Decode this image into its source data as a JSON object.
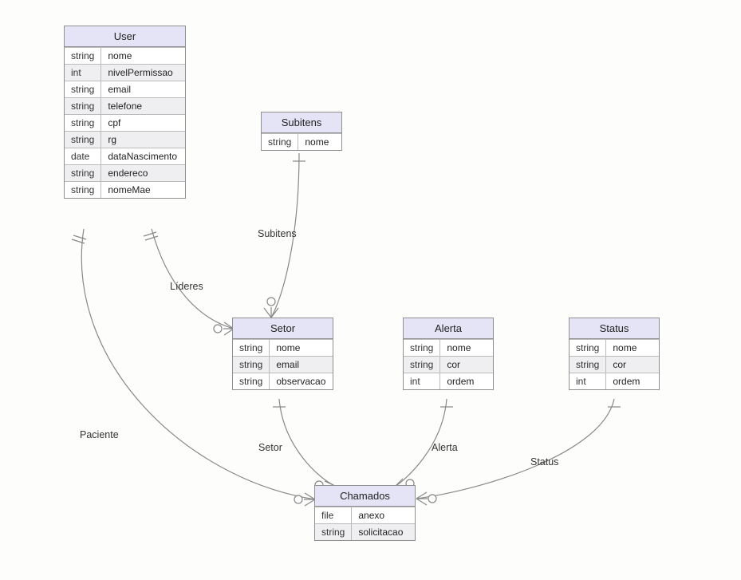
{
  "entities": {
    "user": {
      "title": "User",
      "rows": [
        {
          "type": "string",
          "name": "nome"
        },
        {
          "type": "int",
          "name": "nivelPermissao"
        },
        {
          "type": "string",
          "name": "email"
        },
        {
          "type": "string",
          "name": "telefone"
        },
        {
          "type": "string",
          "name": "cpf"
        },
        {
          "type": "string",
          "name": "rg"
        },
        {
          "type": "date",
          "name": "dataNascimento"
        },
        {
          "type": "string",
          "name": "endereco"
        },
        {
          "type": "string",
          "name": "nomeMae"
        }
      ]
    },
    "subitens": {
      "title": "Subitens",
      "rows": [
        {
          "type": "string",
          "name": "nome"
        }
      ]
    },
    "setor": {
      "title": "Setor",
      "rows": [
        {
          "type": "string",
          "name": "nome"
        },
        {
          "type": "string",
          "name": "email"
        },
        {
          "type": "string",
          "name": "observacao"
        }
      ]
    },
    "alerta": {
      "title": "Alerta",
      "rows": [
        {
          "type": "string",
          "name": "nome"
        },
        {
          "type": "string",
          "name": "cor"
        },
        {
          "type": "int",
          "name": "ordem"
        }
      ]
    },
    "status": {
      "title": "Status",
      "rows": [
        {
          "type": "string",
          "name": "nome"
        },
        {
          "type": "string",
          "name": "cor"
        },
        {
          "type": "int",
          "name": "ordem"
        }
      ]
    },
    "chamados": {
      "title": "Chamados",
      "rows": [
        {
          "type": "file",
          "name": "anexo"
        },
        {
          "type": "string",
          "name": "solicitacao"
        }
      ]
    }
  },
  "relationships": {
    "paciente": "Paciente",
    "lideres": "Líderes",
    "subitens": "Subitens",
    "setor": "Setor",
    "alerta": "Alerta",
    "status": "Status"
  }
}
